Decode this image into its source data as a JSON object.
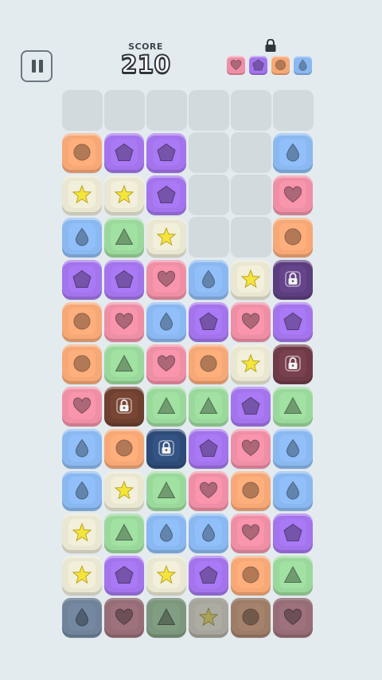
{
  "hud": {
    "score_label": "SCORE",
    "score_value": "210"
  },
  "colors": {
    "background": "#e4ebee",
    "orange": "#f6a877",
    "purple": "#a374ec",
    "blue": "#8ab8f0",
    "cream": "#e9e6d2",
    "pink": "#ef8fa6",
    "green": "#9bd89c",
    "lock_purple": "#5c3e7e",
    "lock_maroon": "#6e3a46",
    "lock_brown": "#6e4030",
    "lock_navy": "#2e4b78"
  },
  "unlock_targets": [
    "heart",
    "pentagon",
    "circle",
    "drop"
  ],
  "board": {
    "columns": 6,
    "empty_cells": [
      [
        0,
        0
      ],
      [
        0,
        1
      ],
      [
        0,
        2
      ],
      [
        0,
        3
      ],
      [
        0,
        4
      ],
      [
        0,
        5
      ],
      [
        1,
        3
      ],
      [
        1,
        4
      ],
      [
        2,
        3
      ],
      [
        2,
        4
      ],
      [
        3,
        3
      ],
      [
        3,
        4
      ]
    ],
    "tiles": [
      {
        "row": 1,
        "col": 0,
        "shape": "circle",
        "color": "orange"
      },
      {
        "row": 1,
        "col": 1,
        "shape": "pentagon",
        "color": "purple"
      },
      {
        "row": 1,
        "col": 2,
        "shape": "pentagon",
        "color": "purple"
      },
      {
        "row": 1,
        "col": 5,
        "shape": "drop",
        "color": "blue"
      },
      {
        "row": 2,
        "col": 0,
        "shape": "star",
        "color": "cream"
      },
      {
        "row": 2,
        "col": 1,
        "shape": "star",
        "color": "cream"
      },
      {
        "row": 2,
        "col": 2,
        "shape": "pentagon",
        "color": "purple"
      },
      {
        "row": 2,
        "col": 5,
        "shape": "heart",
        "color": "pink"
      },
      {
        "row": 3,
        "col": 0,
        "shape": "drop",
        "color": "blue"
      },
      {
        "row": 3,
        "col": 1,
        "shape": "triangle",
        "color": "green"
      },
      {
        "row": 3,
        "col": 2,
        "shape": "star",
        "color": "cream"
      },
      {
        "row": 3,
        "col": 5,
        "shape": "circle",
        "color": "orange"
      },
      {
        "row": 4,
        "col": 0,
        "shape": "pentagon",
        "color": "purple"
      },
      {
        "row": 4,
        "col": 1,
        "shape": "pentagon",
        "color": "purple"
      },
      {
        "row": 4,
        "col": 2,
        "shape": "heart",
        "color": "pink"
      },
      {
        "row": 4,
        "col": 3,
        "shape": "drop",
        "color": "blue"
      },
      {
        "row": 4,
        "col": 4,
        "shape": "star",
        "color": "cream"
      },
      {
        "row": 4,
        "col": 5,
        "shape": "lock",
        "color": "lock_purple"
      },
      {
        "row": 5,
        "col": 0,
        "shape": "circle",
        "color": "orange"
      },
      {
        "row": 5,
        "col": 1,
        "shape": "heart",
        "color": "pink"
      },
      {
        "row": 5,
        "col": 2,
        "shape": "drop",
        "color": "blue"
      },
      {
        "row": 5,
        "col": 3,
        "shape": "pentagon",
        "color": "purple"
      },
      {
        "row": 5,
        "col": 4,
        "shape": "heart",
        "color": "pink"
      },
      {
        "row": 5,
        "col": 5,
        "shape": "pentagon",
        "color": "purple"
      },
      {
        "row": 6,
        "col": 0,
        "shape": "circle",
        "color": "orange"
      },
      {
        "row": 6,
        "col": 1,
        "shape": "triangle",
        "color": "green"
      },
      {
        "row": 6,
        "col": 2,
        "shape": "heart",
        "color": "pink"
      },
      {
        "row": 6,
        "col": 3,
        "shape": "circle",
        "color": "orange"
      },
      {
        "row": 6,
        "col": 4,
        "shape": "star",
        "color": "cream"
      },
      {
        "row": 6,
        "col": 5,
        "shape": "lock",
        "color": "lock_maroon"
      },
      {
        "row": 7,
        "col": 0,
        "shape": "heart",
        "color": "pink"
      },
      {
        "row": 7,
        "col": 1,
        "shape": "lock",
        "color": "lock_brown"
      },
      {
        "row": 7,
        "col": 2,
        "shape": "triangle",
        "color": "green"
      },
      {
        "row": 7,
        "col": 3,
        "shape": "triangle",
        "color": "green"
      },
      {
        "row": 7,
        "col": 4,
        "shape": "pentagon",
        "color": "purple"
      },
      {
        "row": 7,
        "col": 5,
        "shape": "triangle",
        "color": "green"
      },
      {
        "row": 8,
        "col": 0,
        "shape": "drop",
        "color": "blue"
      },
      {
        "row": 8,
        "col": 1,
        "shape": "circle",
        "color": "orange"
      },
      {
        "row": 8,
        "col": 2,
        "shape": "lock",
        "color": "lock_navy"
      },
      {
        "row": 8,
        "col": 3,
        "shape": "pentagon",
        "color": "purple"
      },
      {
        "row": 8,
        "col": 4,
        "shape": "heart",
        "color": "pink"
      },
      {
        "row": 8,
        "col": 5,
        "shape": "drop",
        "color": "blue"
      },
      {
        "row": 9,
        "col": 0,
        "shape": "drop",
        "color": "blue"
      },
      {
        "row": 9,
        "col": 1,
        "shape": "star",
        "color": "cream"
      },
      {
        "row": 9,
        "col": 2,
        "shape": "triangle",
        "color": "green"
      },
      {
        "row": 9,
        "col": 3,
        "shape": "heart",
        "color": "pink"
      },
      {
        "row": 9,
        "col": 4,
        "shape": "circle",
        "color": "orange"
      },
      {
        "row": 9,
        "col": 5,
        "shape": "drop",
        "color": "blue"
      },
      {
        "row": 10,
        "col": 0,
        "shape": "star",
        "color": "cream"
      },
      {
        "row": 10,
        "col": 1,
        "shape": "triangle",
        "color": "green"
      },
      {
        "row": 10,
        "col": 2,
        "shape": "drop",
        "color": "blue"
      },
      {
        "row": 10,
        "col": 3,
        "shape": "drop",
        "color": "blue"
      },
      {
        "row": 10,
        "col": 4,
        "shape": "heart",
        "color": "pink"
      },
      {
        "row": 10,
        "col": 5,
        "shape": "pentagon",
        "color": "purple"
      },
      {
        "row": 11,
        "col": 0,
        "shape": "star",
        "color": "cream"
      },
      {
        "row": 11,
        "col": 1,
        "shape": "pentagon",
        "color": "purple"
      },
      {
        "row": 11,
        "col": 2,
        "shape": "star",
        "color": "cream"
      },
      {
        "row": 11,
        "col": 3,
        "shape": "pentagon",
        "color": "purple"
      },
      {
        "row": 11,
        "col": 4,
        "shape": "circle",
        "color": "orange"
      },
      {
        "row": 11,
        "col": 5,
        "shape": "triangle",
        "color": "green"
      },
      {
        "row": 12,
        "col": 0,
        "shape": "drop",
        "color": "blue",
        "dim": true
      },
      {
        "row": 12,
        "col": 1,
        "shape": "heart",
        "color": "pink",
        "dim": true
      },
      {
        "row": 12,
        "col": 2,
        "shape": "triangle",
        "color": "green",
        "dim": true
      },
      {
        "row": 12,
        "col": 3,
        "shape": "star",
        "color": "cream",
        "dim": true
      },
      {
        "row": 12,
        "col": 4,
        "shape": "circle",
        "color": "orange",
        "dim": true
      },
      {
        "row": 12,
        "col": 5,
        "shape": "heart",
        "color": "pink",
        "dim": true
      }
    ]
  }
}
